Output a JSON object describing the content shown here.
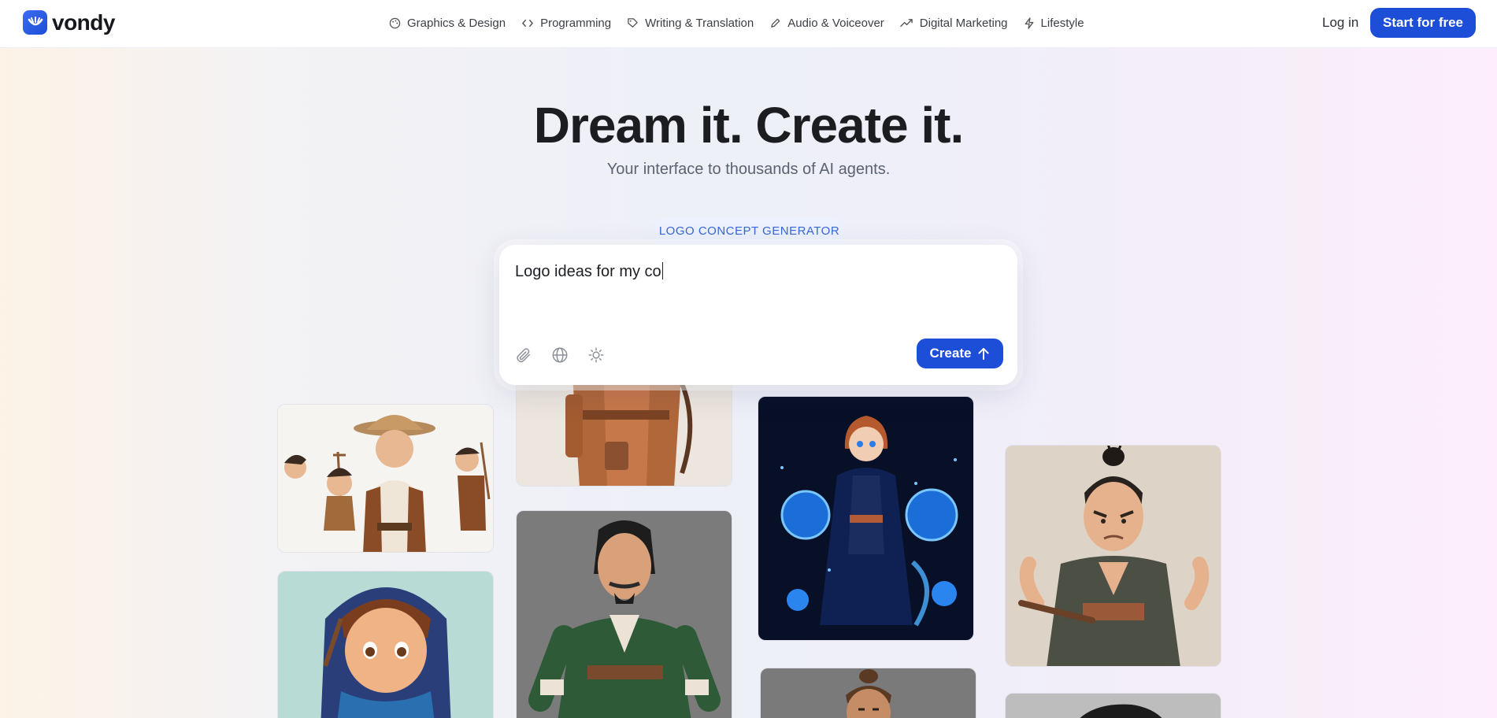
{
  "brand": {
    "name": "vondy",
    "accent": "#1d4ed8"
  },
  "nav": {
    "items": [
      {
        "label": "Graphics & Design",
        "icon": "palette-icon"
      },
      {
        "label": "Programming",
        "icon": "code-icon"
      },
      {
        "label": "Writing & Translation",
        "icon": "pen-tag-icon"
      },
      {
        "label": "Audio & Voiceover",
        "icon": "pen-icon"
      },
      {
        "label": "Digital Marketing",
        "icon": "trend-up-icon"
      },
      {
        "label": "Lifestyle",
        "icon": "bolt-icon"
      }
    ],
    "login_label": "Log in",
    "start_label": "Start for free"
  },
  "hero": {
    "title": "Dream it. Create it.",
    "subtitle": "Your interface to thousands of AI agents."
  },
  "agent": {
    "tab_label": "LOGO CONCEPT GENERATOR",
    "prompt_value": "Logo ideas for my co",
    "tools": [
      "paperclip-icon",
      "globe-icon",
      "sun-icon"
    ],
    "create_label": "Create"
  },
  "gallery": [
    {
      "name": "cowboy-archer-character-sheet"
    },
    {
      "name": "robed-archer-partial"
    },
    {
      "name": "blue-cosmic-mage-girl"
    },
    {
      "name": "samurai-man-dark-kimono"
    },
    {
      "name": "blue-scarf-archer-boy"
    },
    {
      "name": "green-tunic-warrior"
    },
    {
      "name": "topknot-character-partial"
    },
    {
      "name": "dark-haired-character-partial"
    }
  ]
}
